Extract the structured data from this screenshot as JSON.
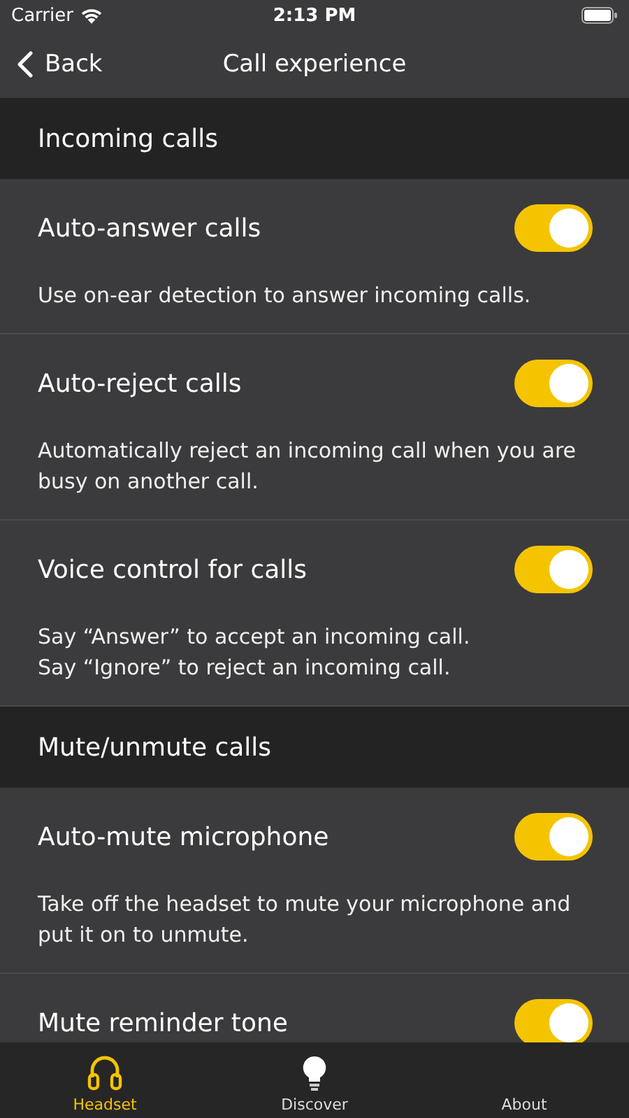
{
  "status_bar": {
    "carrier": "Carrier",
    "time": "2:13 PM"
  },
  "nav": {
    "back": "Back",
    "title": "Call experience"
  },
  "sections": [
    {
      "header": "Incoming calls",
      "settings": [
        {
          "title": "Auto-answer calls",
          "description": "Use on-ear detection to answer incoming calls.",
          "on": true
        },
        {
          "title": "Auto-reject calls",
          "description": "Automatically reject an incoming call when you are busy on another call.",
          "on": true
        },
        {
          "title": "Voice control for calls",
          "description": "Say “Answer” to accept an incoming call.\nSay “Ignore” to reject an incoming call.",
          "on": true
        }
      ]
    },
    {
      "header": "Mute/unmute calls",
      "settings": [
        {
          "title": "Auto-mute microphone",
          "description": "Take off the headset to mute your microphone and put it on to unmute.",
          "on": true
        },
        {
          "title": "Mute reminder tone",
          "on": true
        }
      ]
    }
  ],
  "tabs": [
    {
      "label": "Headset",
      "kind": "headset",
      "selected": true
    },
    {
      "label": "Discover",
      "kind": "bulb",
      "selected": false
    },
    {
      "label": "About",
      "kind": "none",
      "selected": false
    }
  ]
}
